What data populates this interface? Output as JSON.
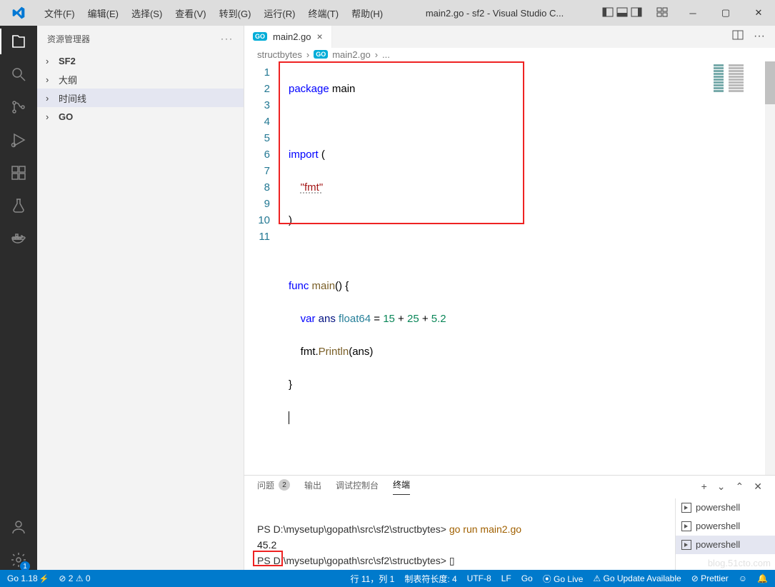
{
  "titlebar": {
    "menus": [
      "文件(F)",
      "编辑(E)",
      "选择(S)",
      "查看(V)",
      "转到(G)",
      "运行(R)",
      "终端(T)",
      "帮助(H)"
    ],
    "title": "main2.go - sf2 - Visual Studio C..."
  },
  "sidebar": {
    "header": "资源管理器",
    "items": [
      {
        "label": "SF2",
        "bold": true
      },
      {
        "label": "大纲"
      },
      {
        "label": "时间线"
      },
      {
        "label": "GO",
        "bold": true
      }
    ]
  },
  "tab": {
    "label": "main2.go"
  },
  "breadcrumb": {
    "a": "structbytes",
    "b": "main2.go",
    "c": "..."
  },
  "code": {
    "l1a": "package",
    "l1b": " main",
    "l3a": "import",
    "l3b": " (",
    "l4": "\"fmt\"",
    "l5": ")",
    "l7a": "func",
    "l7b": " ",
    "l7c": "main",
    "l7d": "() {",
    "l8a": "    ",
    "l8b": "var",
    "l8c": " ans ",
    "l8d": "float64",
    "l8e": " = ",
    "l8f": "15",
    "l8g": " + ",
    "l8h": "25",
    "l8i": " + ",
    "l8j": "5.2",
    "l9a": "    fmt.",
    "l9b": "Println",
    "l9c": "(ans)",
    "l10": "}",
    "lines": [
      "1",
      "2",
      "3",
      "4",
      "5",
      "6",
      "7",
      "8",
      "9",
      "10",
      "11"
    ]
  },
  "panel": {
    "tabs": {
      "problems": "问题",
      "problems_count": "2",
      "output": "输出",
      "debug": "调试控制台",
      "terminal": "终端"
    },
    "term": {
      "prompt1": "PS D:\\mysetup\\gopath\\src\\sf2\\structbytes> ",
      "cmd": "go run main2.go",
      "out": "45.2",
      "prompt2": "PS D:\\mysetup\\gopath\\src\\sf2\\structbytes> ",
      "cursor": "▯"
    },
    "sessions": [
      "powershell",
      "powershell",
      "powershell"
    ]
  },
  "status": {
    "go": "Go 1.18",
    "err": "2",
    "warn": "0",
    "pos": "行 11，列 1",
    "tab": "制表符长度: 4",
    "enc": "UTF-8",
    "eol": "LF",
    "lang": "Go",
    "golive": "Go Live",
    "goupdate": "Go Update Available",
    "prettier": "Prettier"
  },
  "activity_badge": "1"
}
